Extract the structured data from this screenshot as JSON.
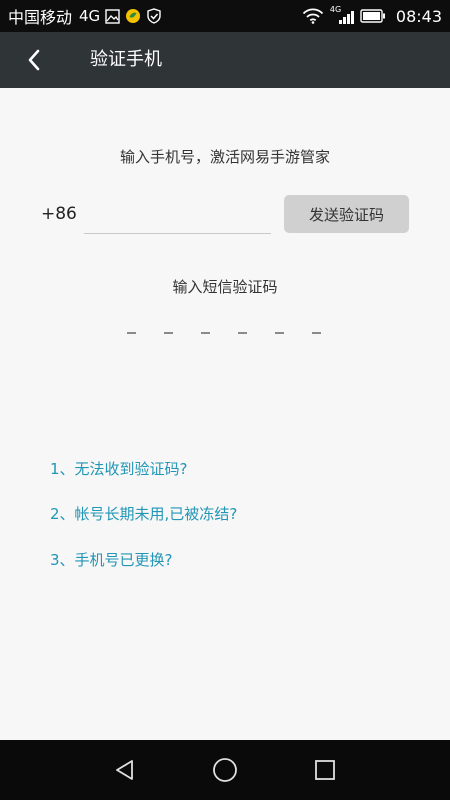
{
  "status_bar": {
    "carrier": "中国移动",
    "network": "4G",
    "time": "08:43",
    "signal_label": "4G",
    "icons": [
      "image-icon",
      "app-badge-icon",
      "shield-check-icon",
      "wifi-icon",
      "signal-icon",
      "battery-icon"
    ]
  },
  "header": {
    "title": "验证手机",
    "background": "#2f3437"
  },
  "form": {
    "hint": "输入手机号，激活网易手游管家",
    "country_code": "+86",
    "phone_value": "",
    "send_button": "发送验证码",
    "sms_label": "输入短信验证码",
    "code_length": 6
  },
  "help_links": [
    "1、无法收到验证码?",
    "2、帐号长期未用,已被冻结?",
    "3、手机号已更换?"
  ],
  "colors": {
    "accent_link": "#2196b6",
    "page_bg": "#f7f7f7",
    "button_bg": "#d0d0d0"
  },
  "nav_bar": {
    "icons": [
      "back-triangle-icon",
      "home-circle-icon",
      "recents-square-icon"
    ]
  }
}
